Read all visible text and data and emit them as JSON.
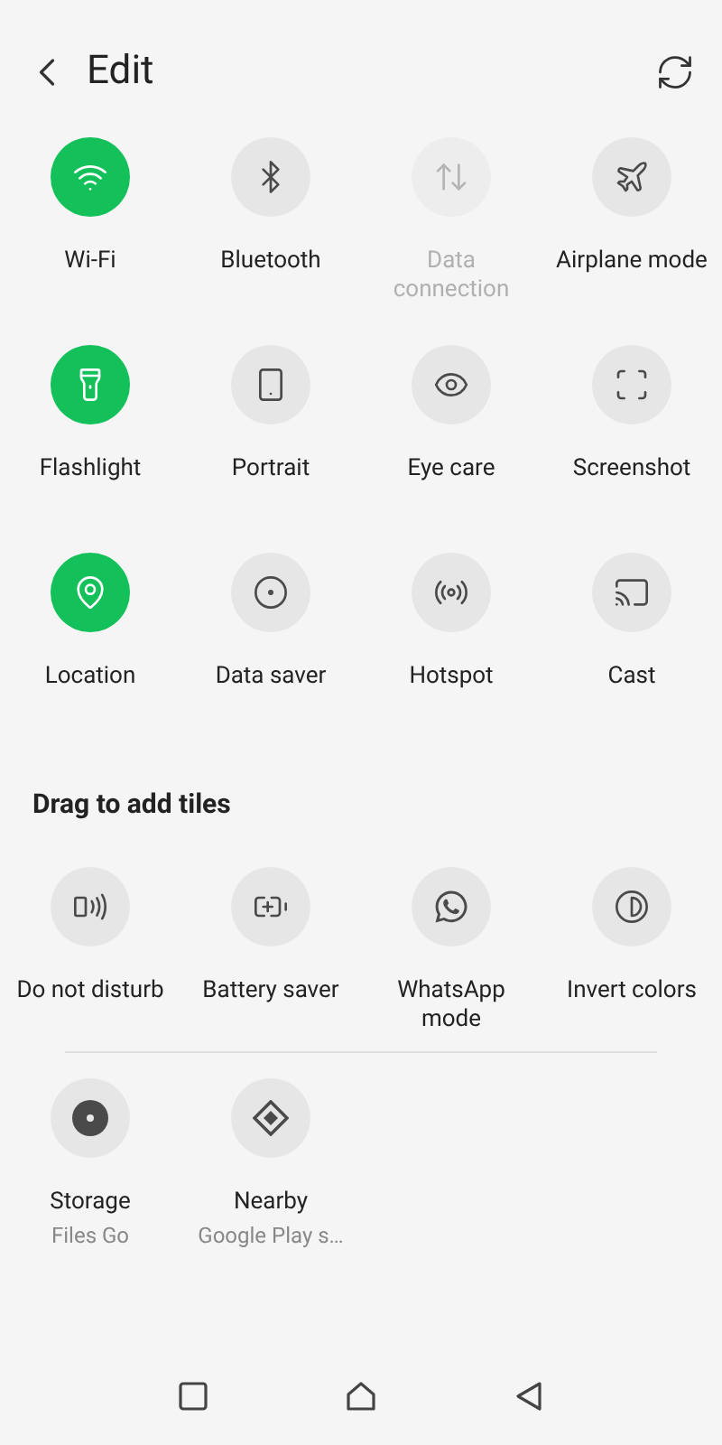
{
  "header": {
    "title": "Edit"
  },
  "active_tiles": [
    {
      "label": "Wi-Fi",
      "kind": "wifi",
      "on": true,
      "disabled": false
    },
    {
      "label": "Bluetooth",
      "kind": "bluetooth",
      "on": false,
      "disabled": false
    },
    {
      "label": "Data connection",
      "kind": "data",
      "on": false,
      "disabled": true
    },
    {
      "label": "Airplane mode",
      "kind": "airplane",
      "on": false,
      "disabled": false
    },
    {
      "label": "Flashlight",
      "kind": "flashlight",
      "on": true,
      "disabled": false
    },
    {
      "label": "Portrait",
      "kind": "rotate",
      "on": false,
      "disabled": false
    },
    {
      "label": "Eye care",
      "kind": "eye",
      "on": false,
      "disabled": false
    },
    {
      "label": "Screenshot",
      "kind": "screenshot",
      "on": false,
      "disabled": false
    },
    {
      "label": "Location",
      "kind": "location",
      "on": true,
      "disabled": false
    },
    {
      "label": "Data saver",
      "kind": "datasaver",
      "on": false,
      "disabled": false
    },
    {
      "label": "Hotspot",
      "kind": "hotspot",
      "on": false,
      "disabled": false
    },
    {
      "label": "Cast",
      "kind": "cast",
      "on": false,
      "disabled": false
    }
  ],
  "drag_heading": "Drag to add tiles",
  "available_groups": [
    {
      "tiles": [
        {
          "label": "Do not disturb",
          "kind": "dnd"
        },
        {
          "label": "Battery saver",
          "kind": "battery"
        },
        {
          "label": "WhatsApp mode",
          "kind": "whatsapp"
        },
        {
          "label": "Invert colors",
          "kind": "invert"
        }
      ]
    },
    {
      "tiles": [
        {
          "label": "Storage",
          "subtitle": "Files Go",
          "kind": "storage"
        },
        {
          "label": "Nearby",
          "subtitle": "Google Play s…",
          "kind": "nearby"
        }
      ]
    }
  ]
}
